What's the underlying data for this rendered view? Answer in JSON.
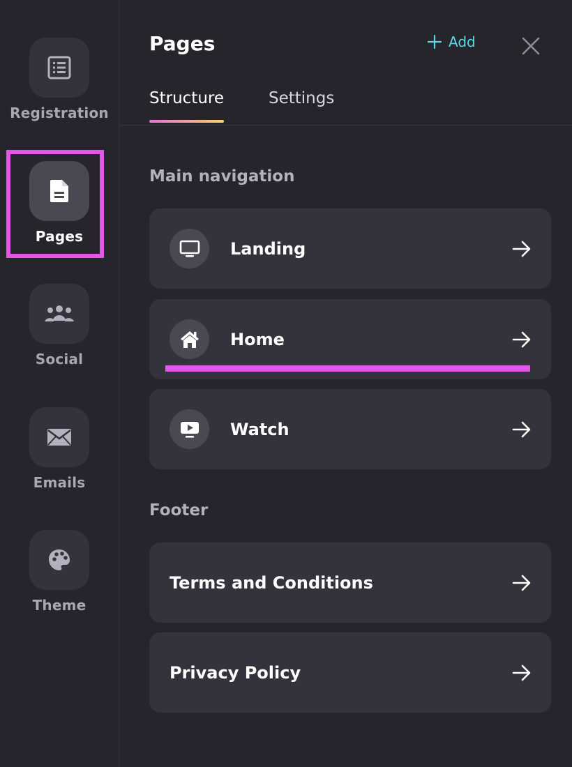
{
  "sidebar": {
    "items": [
      {
        "label": "Registration",
        "icon": "list-icon"
      },
      {
        "label": "Pages",
        "icon": "document-icon",
        "active": true
      },
      {
        "label": "Social",
        "icon": "people-icon"
      },
      {
        "label": "Emails",
        "icon": "envelope-icon"
      },
      {
        "label": "Theme",
        "icon": "palette-icon"
      }
    ]
  },
  "panel": {
    "title": "Pages",
    "add_label": "Add",
    "tabs": [
      {
        "label": "Structure",
        "active": true
      },
      {
        "label": "Settings",
        "active": false
      }
    ]
  },
  "sections": {
    "main_nav": {
      "title": "Main navigation",
      "items": [
        {
          "label": "Landing",
          "icon": "monitor-icon"
        },
        {
          "label": "Home",
          "icon": "home-icon"
        },
        {
          "label": "Watch",
          "icon": "play-icon"
        }
      ]
    },
    "footer": {
      "title": "Footer",
      "items": [
        {
          "label": "Terms and Conditions"
        },
        {
          "label": "Privacy Policy"
        }
      ]
    }
  },
  "colors": {
    "background": "#26252c",
    "card": "#34333b",
    "accent_add": "#5fd9e8",
    "highlight": "#e456e6"
  }
}
